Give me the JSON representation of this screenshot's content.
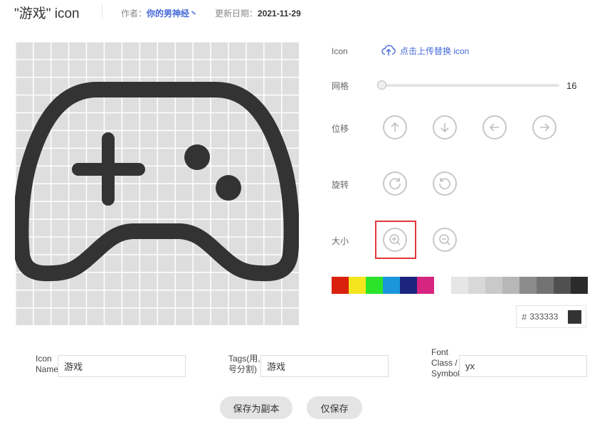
{
  "header": {
    "title": "\"游戏\" icon",
    "author_label": "作者：",
    "author_name": "你的男神经丶",
    "update_label": "更新日期：",
    "update_date": "2021-11-29"
  },
  "controls": {
    "icon_label": "Icon",
    "upload_text": "点击上传替换 icon",
    "grid_label": "网格",
    "grid_value": "16",
    "move_label": "位移",
    "rotate_label": "旋转",
    "size_label": "大小"
  },
  "palette": [
    "#d9210d",
    "#f4e51f",
    "#2ae32a",
    "#1b96dc",
    "#1b257e",
    "#d62580",
    "#ffffff",
    "#e6e6e6",
    "#d8d8d8",
    "#c9c9c9",
    "#b7b7b7",
    "#8c8c8c",
    "#737373",
    "#505050",
    "#2b2b2b"
  ],
  "color": {
    "hash": "#",
    "hex": "333333",
    "value": "#333333"
  },
  "form": {
    "icon_name_label_1": "Icon",
    "icon_name_label_2": "Name",
    "icon_name_value": "游戏",
    "tags_label_1": "Tags(用,",
    "tags_label_2": "号分割)",
    "tags_value": "游戏",
    "font_class_label_1": "Font",
    "font_class_label_2": "Class /",
    "font_class_label_3": "Symbol",
    "font_class_value": "yx"
  },
  "buttons": {
    "save_copy": "保存为副本",
    "save_only": "仅保存"
  }
}
